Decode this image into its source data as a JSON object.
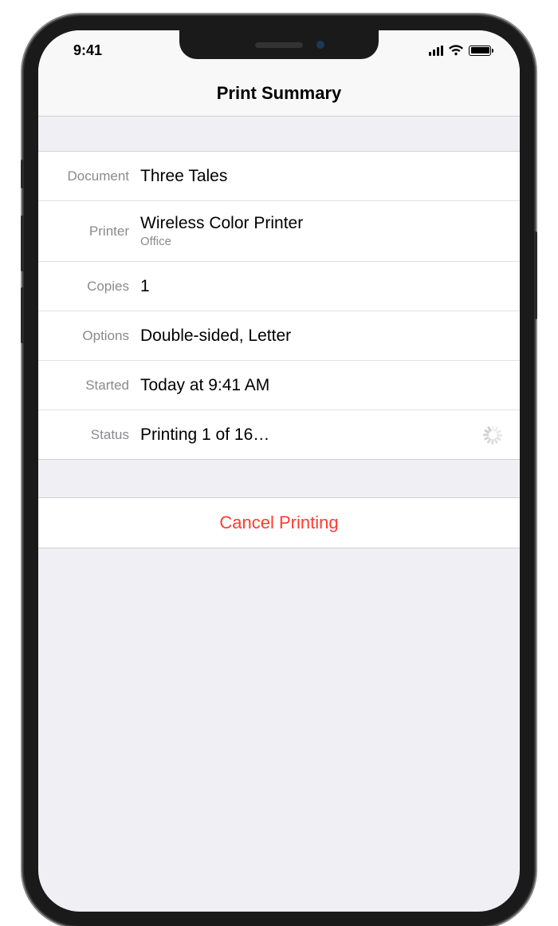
{
  "statusbar": {
    "time": "9:41"
  },
  "header": {
    "title": "Print Summary"
  },
  "rows": {
    "document": {
      "label": "Document",
      "value": "Three Tales"
    },
    "printer": {
      "label": "Printer",
      "value": "Wireless Color Printer",
      "sub": "Office"
    },
    "copies": {
      "label": "Copies",
      "value": "1"
    },
    "options": {
      "label": "Options",
      "value": "Double-sided, Letter"
    },
    "started": {
      "label": "Started",
      "value": "Today at 9:41 AM"
    },
    "status": {
      "label": "Status",
      "value": "Printing 1 of 16…"
    }
  },
  "actions": {
    "cancel": "Cancel Printing"
  }
}
